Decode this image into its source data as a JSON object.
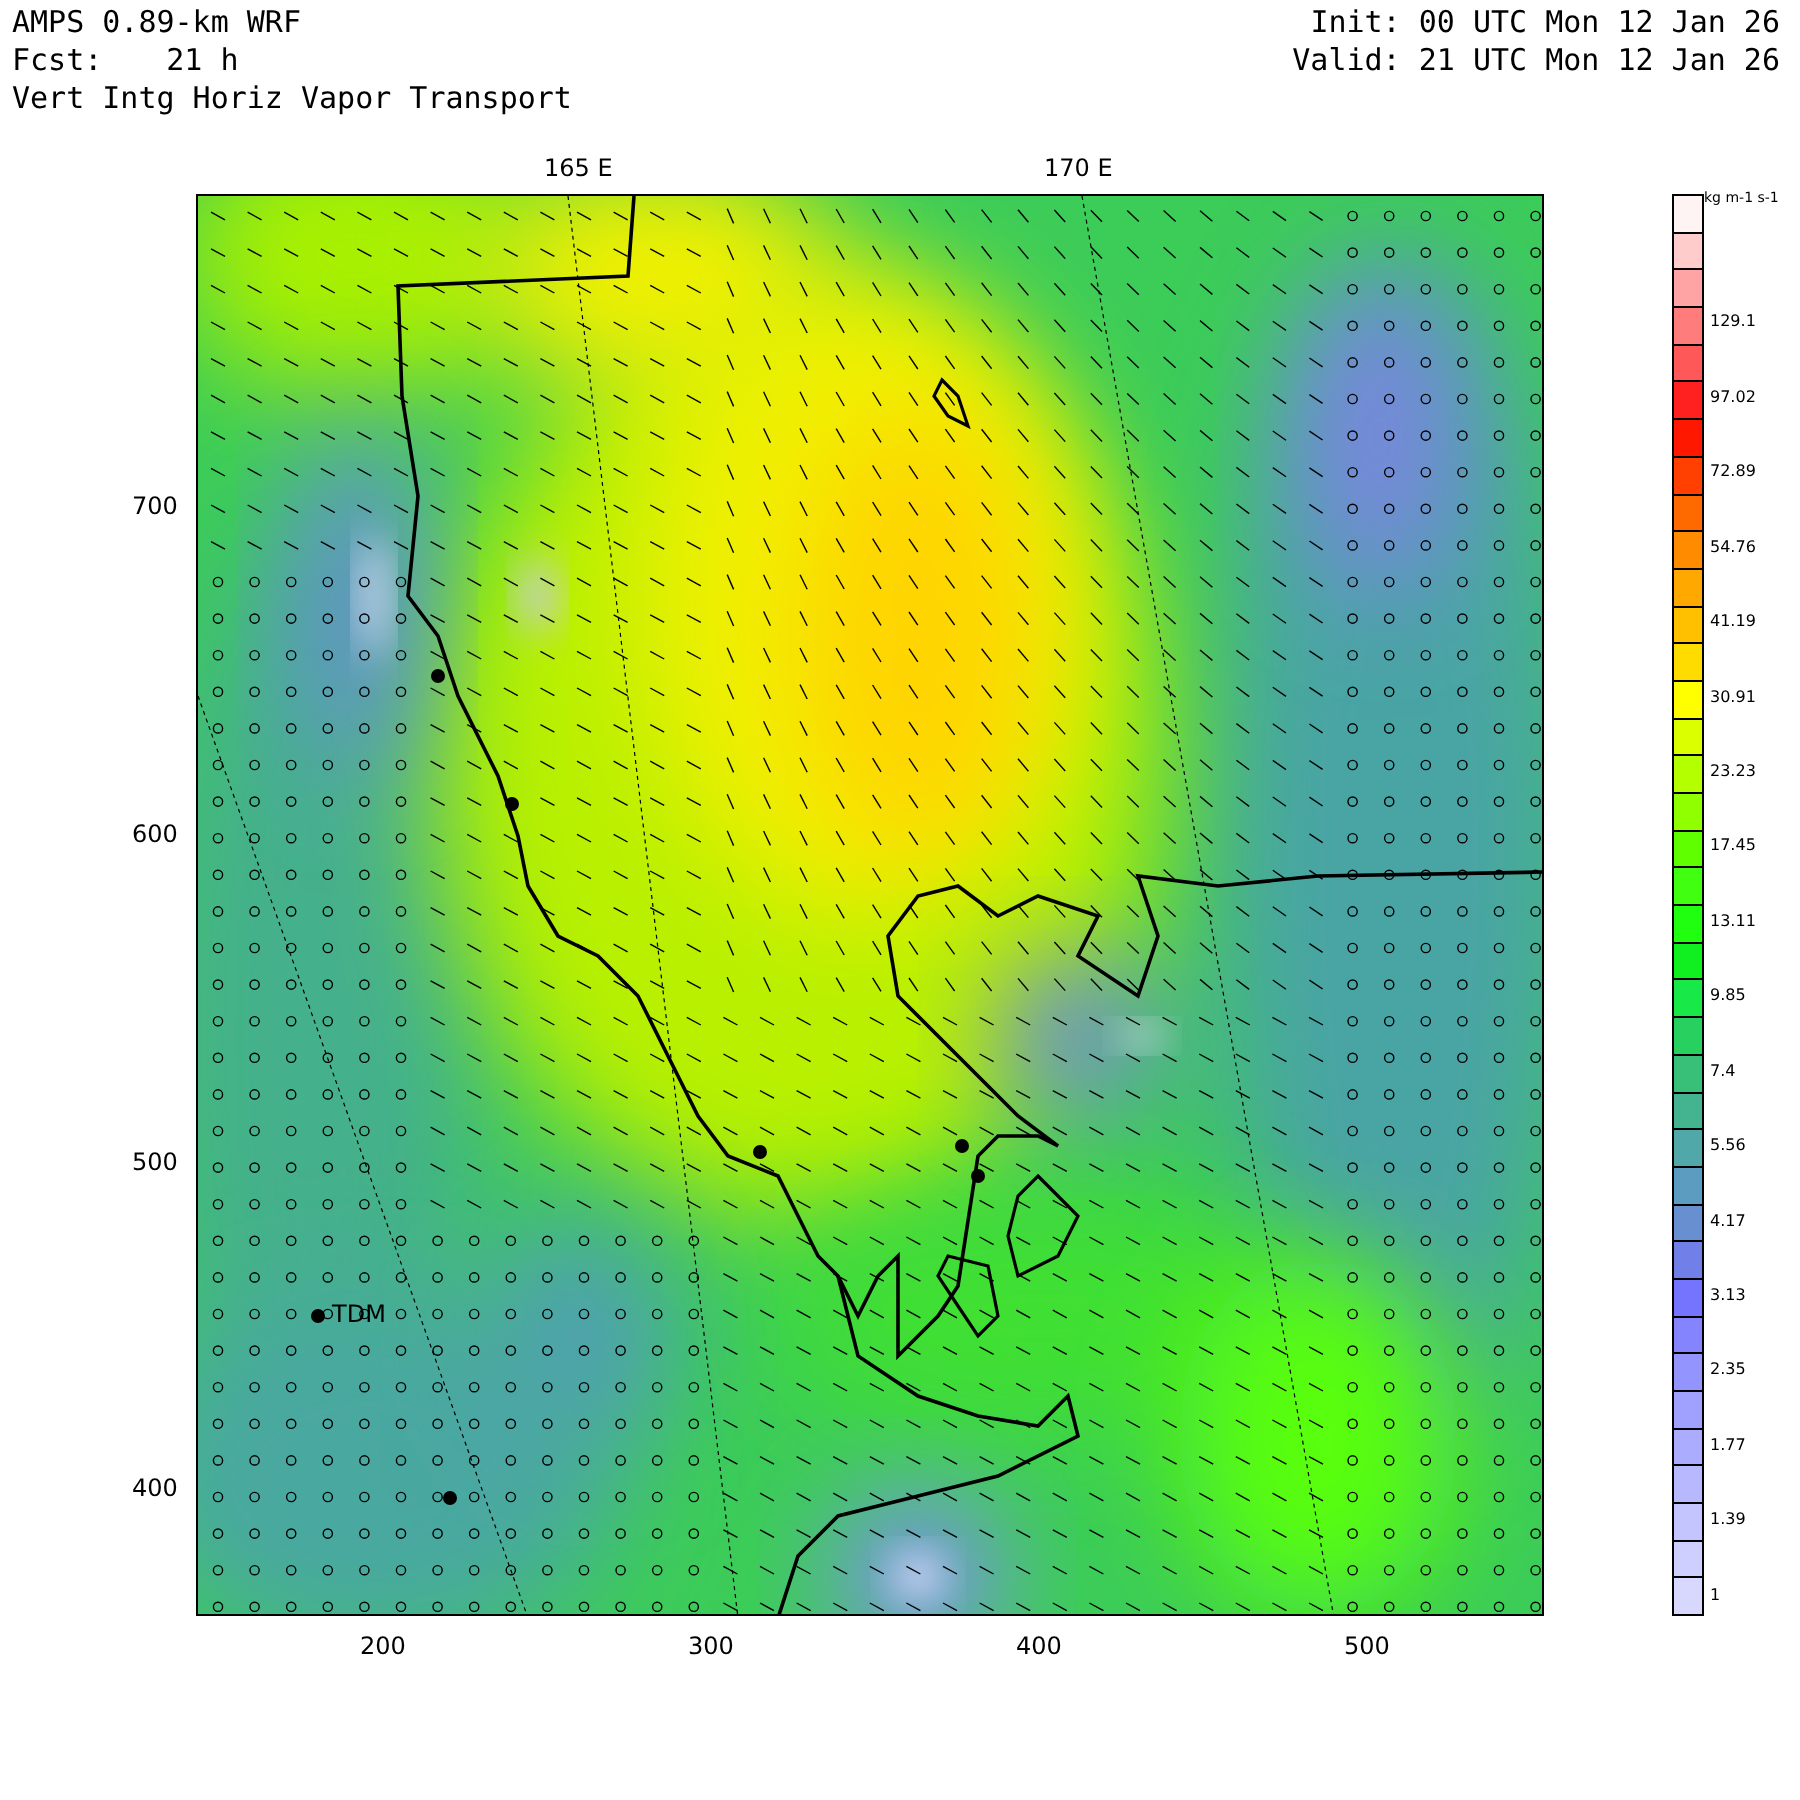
{
  "header": {
    "model": "AMPS 0.89-km WRF",
    "forecast_label": "Fcst:",
    "forecast_hours": "21 h",
    "field": "Vert Intg Horiz Vapor Transport",
    "init": "Init: 00 UTC Mon 12 Jan 26",
    "valid": "Valid: 21 UTC Mon 12 Jan 26"
  },
  "map": {
    "top_labels": [
      "165 E",
      "170 E"
    ],
    "x_ticks": [
      "200",
      "300",
      "400",
      "500"
    ],
    "y_ticks": [
      "700",
      "600",
      "500",
      "400"
    ],
    "station_label": "TDM"
  },
  "colorbar": {
    "units": "kg m-1 s-1",
    "boxes": [
      {
        "color": "#fff4f4"
      },
      {
        "color": "#ffcccc"
      },
      {
        "color": "#ffa4a4"
      },
      {
        "color": "#ff7c7c",
        "label": "129.1"
      },
      {
        "color": "#ff5858"
      },
      {
        "color": "#ff2020",
        "label": "97.02"
      },
      {
        "color": "#ff1800"
      },
      {
        "color": "#ff4000",
        "label": "72.89"
      },
      {
        "color": "#ff6a00"
      },
      {
        "color": "#ff8c00",
        "label": "54.76"
      },
      {
        "color": "#ffa800"
      },
      {
        "color": "#ffc000",
        "label": "41.19"
      },
      {
        "color": "#ffdc00"
      },
      {
        "color": "#ffff00",
        "label": "30.91"
      },
      {
        "color": "#dcff00"
      },
      {
        "color": "#b4ff00",
        "label": "23.23"
      },
      {
        "color": "#90ff00"
      },
      {
        "color": "#60ff00",
        "label": "17.45"
      },
      {
        "color": "#40ff10"
      },
      {
        "color": "#20ff10",
        "label": "13.11"
      },
      {
        "color": "#10f020"
      },
      {
        "color": "#18e848",
        "label": "9.85"
      },
      {
        "color": "#28d060"
      },
      {
        "color": "#38c078",
        "label": "7.4"
      },
      {
        "color": "#44b490"
      },
      {
        "color": "#50a8a8",
        "label": "5.56"
      },
      {
        "color": "#5c9cc0"
      },
      {
        "color": "#6890d0",
        "label": "4.17"
      },
      {
        "color": "#7080e8"
      },
      {
        "color": "#7474ff",
        "label": "3.13"
      },
      {
        "color": "#8484ff"
      },
      {
        "color": "#9494ff",
        "label": "2.35"
      },
      {
        "color": "#a0a0ff"
      },
      {
        "color": "#acacff",
        "label": "1.77"
      },
      {
        "color": "#b8b8ff"
      },
      {
        "color": "#c4c4ff",
        "label": "1.39"
      },
      {
        "color": "#ceceff"
      },
      {
        "color": "#d8d8ff",
        "label": "1"
      }
    ]
  }
}
